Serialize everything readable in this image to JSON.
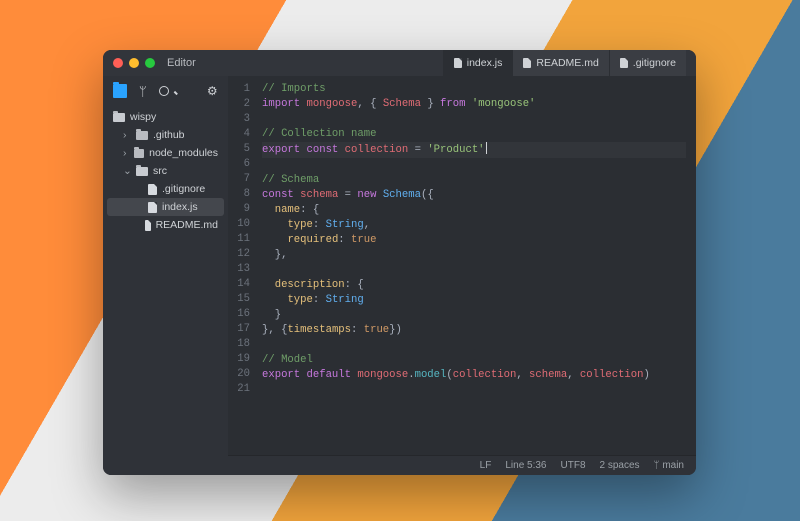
{
  "window": {
    "title": "Editor"
  },
  "tabs": [
    {
      "label": "index.js",
      "active": true
    },
    {
      "label": "README.md",
      "active": false
    },
    {
      "label": ".gitignore",
      "active": false
    }
  ],
  "sidebar": {
    "root": "wispy",
    "items": [
      {
        "kind": "folder",
        "label": ".github",
        "expanded": false,
        "depth": 1
      },
      {
        "kind": "folder",
        "label": "node_modules",
        "expanded": false,
        "depth": 1
      },
      {
        "kind": "folder",
        "label": "src",
        "expanded": true,
        "depth": 1
      },
      {
        "kind": "file",
        "label": ".gitignore",
        "depth": 2
      },
      {
        "kind": "file",
        "label": "index.js",
        "depth": 2,
        "selected": true
      },
      {
        "kind": "file",
        "label": "README.md",
        "depth": 2
      }
    ]
  },
  "code": {
    "lines": [
      [
        {
          "c": "c-comm",
          "t": "// Imports"
        }
      ],
      [
        {
          "c": "c-kw",
          "t": "import"
        },
        {
          "t": " "
        },
        {
          "c": "c-id",
          "t": "mongoose"
        },
        {
          "c": "c-op",
          "t": ", { "
        },
        {
          "c": "c-id",
          "t": "Schema"
        },
        {
          "c": "c-op",
          "t": " } "
        },
        {
          "c": "c-kw",
          "t": "from"
        },
        {
          "t": " "
        },
        {
          "c": "c-str",
          "t": "'mongoose'"
        }
      ],
      [],
      [
        {
          "c": "c-comm",
          "t": "// Collection name"
        }
      ],
      [
        {
          "c": "c-kw",
          "t": "export const"
        },
        {
          "t": " "
        },
        {
          "c": "c-id",
          "t": "collection"
        },
        {
          "c": "c-op",
          "t": " = "
        },
        {
          "c": "c-str",
          "t": "'Product'"
        },
        {
          "cursor": true
        }
      ],
      [],
      [
        {
          "c": "c-comm",
          "t": "// Schema"
        }
      ],
      [
        {
          "c": "c-kw",
          "t": "const"
        },
        {
          "t": " "
        },
        {
          "c": "c-id",
          "t": "schema"
        },
        {
          "c": "c-op",
          "t": " = "
        },
        {
          "c": "c-kw",
          "t": "new"
        },
        {
          "t": " "
        },
        {
          "c": "c-type",
          "t": "Schema"
        },
        {
          "c": "c-op",
          "t": "({"
        }
      ],
      [
        {
          "t": "  "
        },
        {
          "c": "c-prop",
          "t": "name"
        },
        {
          "c": "c-op",
          "t": ": {"
        }
      ],
      [
        {
          "t": "    "
        },
        {
          "c": "c-prop",
          "t": "type"
        },
        {
          "c": "c-op",
          "t": ": "
        },
        {
          "c": "c-type",
          "t": "String"
        },
        {
          "c": "c-op",
          "t": ","
        }
      ],
      [
        {
          "t": "    "
        },
        {
          "c": "c-prop",
          "t": "required"
        },
        {
          "c": "c-op",
          "t": ": "
        },
        {
          "c": "c-bool",
          "t": "true"
        }
      ],
      [
        {
          "t": "  "
        },
        {
          "c": "c-op",
          "t": "},"
        }
      ],
      [],
      [
        {
          "t": "  "
        },
        {
          "c": "c-prop",
          "t": "description"
        },
        {
          "c": "c-op",
          "t": ": {"
        }
      ],
      [
        {
          "t": "    "
        },
        {
          "c": "c-prop",
          "t": "type"
        },
        {
          "c": "c-op",
          "t": ": "
        },
        {
          "c": "c-type",
          "t": "String"
        }
      ],
      [
        {
          "t": "  "
        },
        {
          "c": "c-op",
          "t": "}"
        }
      ],
      [
        {
          "c": "c-op",
          "t": "}, {"
        },
        {
          "c": "c-prop",
          "t": "timestamps"
        },
        {
          "c": "c-op",
          "t": ": "
        },
        {
          "c": "c-bool",
          "t": "true"
        },
        {
          "c": "c-op",
          "t": "})"
        }
      ],
      [],
      [
        {
          "c": "c-comm",
          "t": "// Model"
        }
      ],
      [
        {
          "c": "c-kw",
          "t": "export default"
        },
        {
          "t": " "
        },
        {
          "c": "c-id",
          "t": "mongoose"
        },
        {
          "c": "c-op",
          "t": "."
        },
        {
          "c": "c-fn",
          "t": "model"
        },
        {
          "c": "c-op",
          "t": "("
        },
        {
          "c": "c-id",
          "t": "collection"
        },
        {
          "c": "c-op",
          "t": ", "
        },
        {
          "c": "c-id",
          "t": "schema"
        },
        {
          "c": "c-op",
          "t": ", "
        },
        {
          "c": "c-id",
          "t": "collection"
        },
        {
          "c": "c-op",
          "t": ")"
        }
      ],
      []
    ],
    "active_line": 5
  },
  "statusbar": {
    "eol": "LF",
    "cursor": "Line 5:36",
    "encoding": "UTF8",
    "indent": "2 spaces",
    "branch_glyph": "ᛘ",
    "branch": "main"
  }
}
